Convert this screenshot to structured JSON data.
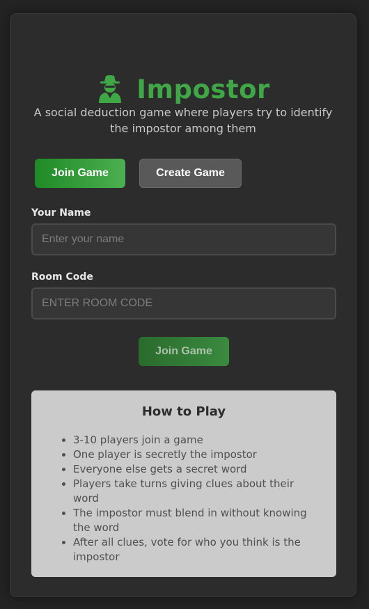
{
  "app": {
    "title": "Impostor",
    "subtitle": "A social deduction game where players try to identify the impostor among them",
    "icon": "spy-icon",
    "accent_color": "#3fa745"
  },
  "mode_tabs": {
    "join_label": "Join Game",
    "create_label": "Create Game",
    "active": "join"
  },
  "form": {
    "name_label": "Your Name",
    "name_placeholder": "Enter your name",
    "name_value": "",
    "room_label": "Room Code",
    "room_placeholder": "ENTER ROOM CODE",
    "room_value": "",
    "submit_label": "Join Game"
  },
  "how_to_play": {
    "title": "How to Play",
    "rules": [
      "3-10 players join a game",
      "One player is secretly the impostor",
      "Everyone else gets a secret word",
      "Players take turns giving clues about their word",
      "The impostor must blend in without knowing the word",
      "After all clues, vote for who you think is the impostor"
    ]
  }
}
